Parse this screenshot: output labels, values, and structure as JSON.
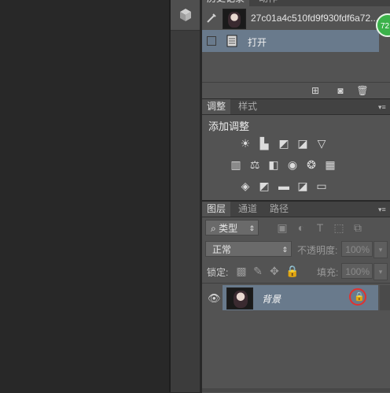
{
  "history_panel": {
    "tabs": [
      "历史记录",
      "动作"
    ],
    "snapshot_name": "27c01a4c510fd9f930fdf6a72...",
    "step_label": "打开",
    "footer_icons": [
      "new-document-from-state-icon",
      "camera-icon",
      "trash-icon"
    ]
  },
  "adjustments_panel": {
    "tabs": [
      "调整",
      "样式"
    ],
    "heading": "添加调整",
    "icon_rows": [
      [
        "brightness-contrast-icon",
        "levels-icon",
        "curves-icon",
        "exposure-icon",
        "vibrance-icon"
      ],
      [
        "hue-saturation-icon",
        "color-balance-icon",
        "black-white-icon",
        "photo-filter-icon",
        "channel-mixer-icon",
        "color-lookup-icon"
      ],
      [
        "invert-icon",
        "posterize-icon",
        "threshold-icon",
        "selective-color-icon",
        "gradient-map-icon"
      ]
    ]
  },
  "layers_panel": {
    "tabs": [
      "图层",
      "通道",
      "路径"
    ],
    "filter_kind": "类型",
    "blend_mode": "正常",
    "opacity_label": "不透明度:",
    "opacity_value": "100%",
    "lock_label": "锁定:",
    "fill_label": "填充:",
    "fill_value": "100%",
    "layer_name": "背景"
  },
  "badge": {
    "text": "72"
  },
  "colors": {
    "panel": "#535353",
    "selected_row": "#697a8c",
    "lock_highlight": "#e2312f"
  }
}
